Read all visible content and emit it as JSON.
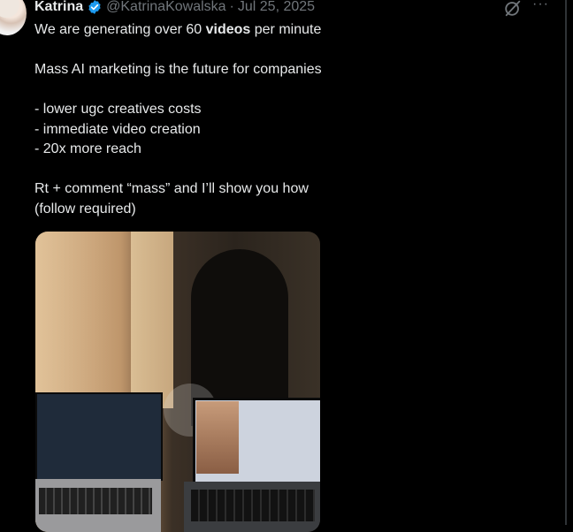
{
  "tweet": {
    "author_name": "Katrina",
    "handle": "@KatrinaKowalska",
    "separator": "·",
    "date": "Jul 25, 2025",
    "line1_pre": "We are generating over 60 ",
    "line1_bold": "videos",
    "line1_post": " per minute",
    "line2": "Mass AI marketing is the future for companies",
    "line3": "- lower ugc creatives costs",
    "line4": "- immediate video creation",
    "line5": "- 20x more reach",
    "line6": "Rt + comment “mass” and I’ll show you how",
    "line7": "(follow required)",
    "more_label": "···"
  },
  "icons": {
    "verified": "verified-badge-icon",
    "grok": "grok-icon",
    "more": "more-options-icon"
  },
  "colors": {
    "background": "#000000",
    "text": "#e7e9ea",
    "muted": "#71767b",
    "verified": "#1d9bf0"
  }
}
